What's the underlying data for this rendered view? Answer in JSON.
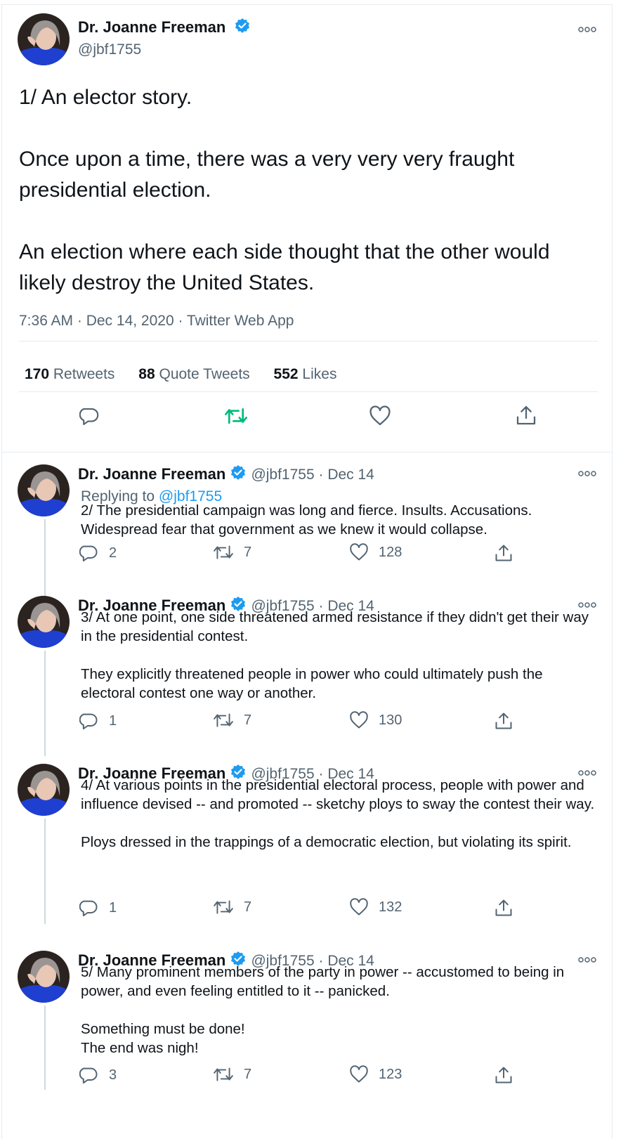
{
  "main_tweet": {
    "author": "Dr. Joanne Freeman",
    "handle": "@jbf1755",
    "paragraphs": [
      "1/ An elector story.",
      "Once upon a time, there was a very very very fraught presidential election.",
      "An election where each side thought that the other would likely destroy the United States."
    ],
    "meta": "7:36 AM · Dec 14, 2020 · Twitter Web App",
    "retweets_count": "170",
    "retweets_label": "Retweets",
    "quotes_count": "88",
    "quotes_label": "Quote Tweets",
    "likes_count": "552",
    "likes_label": "Likes"
  },
  "replies": [
    {
      "author": "Dr. Joanne Freeman",
      "handle": "@jbf1755 · Dec 14",
      "replying_prefix": "Replying to",
      "replying_handle": "@jbf1755",
      "paragraphs": [
        "2/ The presidential campaign was long and fierce. Insults. Accusations. Widespread fear that government as we knew it would collapse."
      ],
      "reply_count": "2",
      "retweet_count": "7",
      "like_count": "128"
    },
    {
      "author": "Dr. Joanne Freeman",
      "handle": "@jbf1755 · Dec 14",
      "paragraphs": [
        "3/ At one point, one side threatened armed resistance if they didn't get their way in the presidential contest.",
        "They explicitly threatened people in power who could ultimately push the electoral contest one way or another."
      ],
      "reply_count": "1",
      "retweet_count": "7",
      "like_count": "130"
    },
    {
      "author": "Dr. Joanne Freeman",
      "handle": "@jbf1755 · Dec 14",
      "paragraphs": [
        "4/ At various points in the presidential electoral process, people with power and influence devised -- and promoted -- sketchy ploys to sway the contest their way.",
        "Ploys dressed in the trappings of a democratic election, but violating its spirit."
      ],
      "reply_count": "1",
      "retweet_count": "7",
      "like_count": "132"
    },
    {
      "author": "Dr. Joanne Freeman",
      "handle": "@jbf1755 · Dec 14",
      "paragraphs": [
        "5/ Many prominent members of the party in power --  accustomed to being in power, and even feeling entitled to it -- panicked.",
        "Something must be done!\nThe end was nigh!"
      ],
      "reply_count": "3",
      "retweet_count": "7",
      "like_count": "123"
    }
  ],
  "icons": {
    "reply": "speech-bubble-icon",
    "retweet": "retweet-arrows-icon",
    "like": "heart-icon",
    "share": "share-upload-icon",
    "verified": "verified-badge-icon",
    "more": "more-dots-icon"
  },
  "colors": {
    "verified_blue": "#1d9bf0",
    "retweet_green": "#00ba7c",
    "secondary_text": "#536471"
  }
}
